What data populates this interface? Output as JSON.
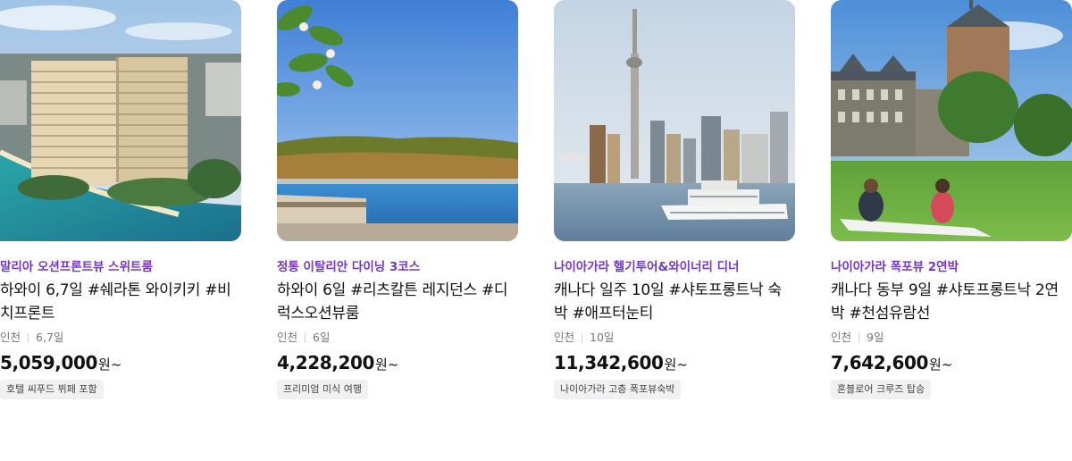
{
  "products": [
    {
      "image_icon": "hotel-beach-photo",
      "highlight": "말리아 오션프론트뷰 스위트룸",
      "title": "하와이 6,7일 #쉐라톤 와이키키 #비치프론트",
      "departure": "인천",
      "duration": "6,7일",
      "price": "5,059,000",
      "price_unit": "원~",
      "tag": "호텔 씨푸드 뷔페 포함"
    },
    {
      "image_icon": "infinity-pool-photo",
      "highlight": "정통 이탈리안 다이닝 3코스",
      "title": "하와이 6일 #리츠칼튼 레지던스 #디럭스오션뷰룸",
      "departure": "인천",
      "duration": "6일",
      "price": "4,228,200",
      "price_unit": "원~",
      "tag": "프리미엄 미식 여행"
    },
    {
      "image_icon": "toronto-skyline-photo",
      "highlight": "나이아가라 헬기투어&와이너리 디너",
      "title": "캐나다 일주 10일 #샤토프롱트낙 숙박 #애프터눈티",
      "departure": "인천",
      "duration": "10일",
      "price": "11,342,600",
      "price_unit": "원~",
      "tag": "나이아가라 고층 폭포뷰숙박"
    },
    {
      "image_icon": "chateau-picnic-photo",
      "highlight": "나이아가라 폭포뷰 2연박",
      "title": "캐나다 동부 9일 #샤토프롱트낙 2연박 #천섬유람선",
      "departure": "인천",
      "duration": "9일",
      "price": "7,642,600",
      "price_unit": "원~",
      "tag": "혼블로어 크루즈 탑승"
    }
  ],
  "colors": {
    "accent": "#7535d1",
    "tag_bg": "#f1f1f3"
  }
}
